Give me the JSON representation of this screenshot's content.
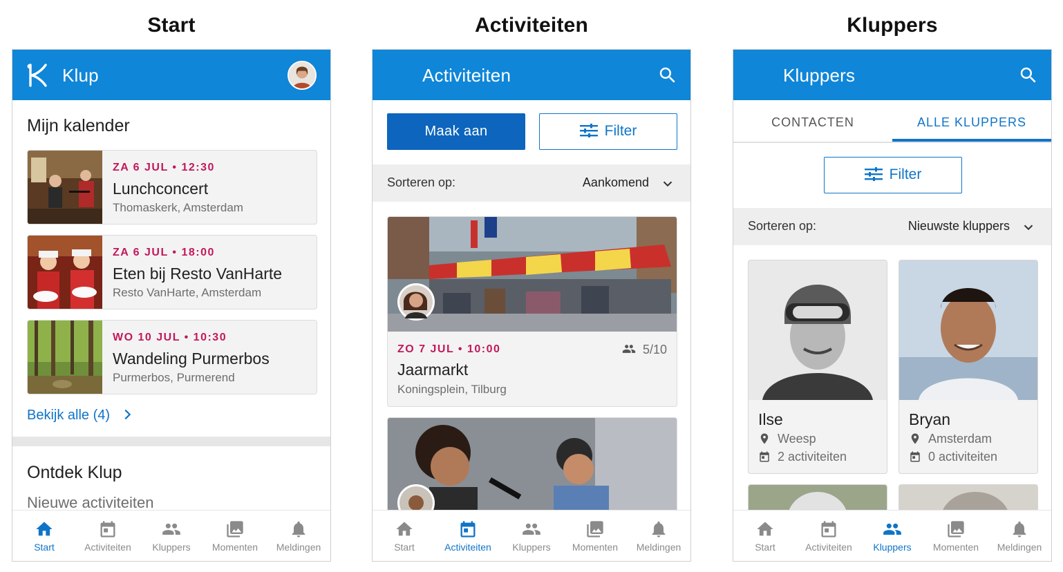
{
  "captions": [
    "Start",
    "Activiteiten",
    "Kluppers"
  ],
  "colors": {
    "primary": "#0f86d8",
    "date_accent": "#c2185b",
    "link": "#0f74c8"
  },
  "nav": [
    "Start",
    "Activiteiten",
    "Kluppers",
    "Momenten",
    "Meldingen"
  ],
  "start": {
    "app_title": "Klup",
    "calendar_title": "Mijn kalender",
    "events": [
      {
        "date": "ZA 6 JUL • 12:30",
        "name": "Lunchconcert",
        "place": "Thomaskerk, Amsterdam"
      },
      {
        "date": "ZA 6 JUL • 18:00",
        "name": "Eten bij Resto VanHarte",
        "place": "Resto VanHarte, Amsterdam"
      },
      {
        "date": "WO 10 JUL • 10:30",
        "name": "Wandeling Purmerbos",
        "place": "Purmerbos, Purmerend"
      }
    ],
    "view_all": "Bekijk alle (4)",
    "discover_title": "Ontdek Klup",
    "new_activities": "Nieuwe activiteiten"
  },
  "activities": {
    "title": "Activiteiten",
    "create_label": "Maak aan",
    "filter_label": "Filter",
    "sort_label": "Sorteren op:",
    "sort_value": "Aankomend",
    "items": [
      {
        "date": "ZO 7 JUL • 10:00",
        "name": "Jaarmarkt",
        "place": "Koningsplein, Tilburg",
        "participants": "5/10"
      }
    ]
  },
  "kluppers": {
    "title": "Kluppers",
    "tabs": [
      "CONTACTEN",
      "ALLE KLUPPERS"
    ],
    "filter_label": "Filter",
    "sort_label": "Sorteren op:",
    "sort_value": "Nieuwste kluppers",
    "people": [
      {
        "name": "Ilse",
        "city": "Weesp",
        "activities": "2 activiteiten"
      },
      {
        "name": "Bryan",
        "city": "Amsterdam",
        "activities": "0 activiteiten"
      }
    ]
  }
}
